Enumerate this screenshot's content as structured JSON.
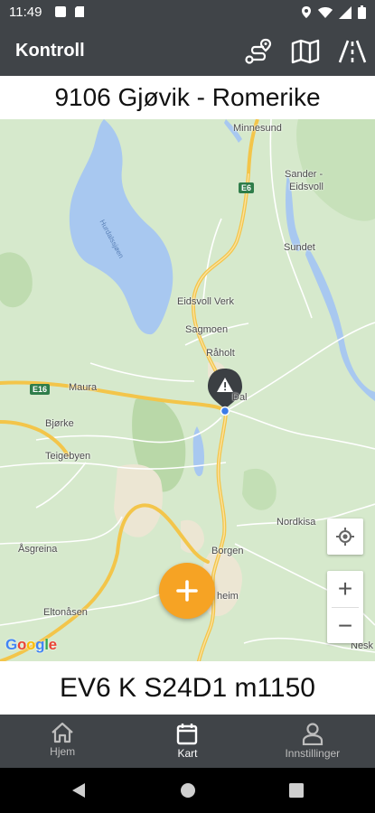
{
  "status_bar": {
    "time": "11:49",
    "left_icons": [
      "app-notification-icon",
      "sd-card-icon"
    ],
    "right_icons": [
      "location-icon",
      "wifi-icon",
      "signal-icon",
      "battery-icon"
    ]
  },
  "app_bar": {
    "title": "Kontroll",
    "actions": [
      "route-icon",
      "map-icon",
      "road-icon"
    ]
  },
  "route_title": "9106 Gjøvik - Romerike",
  "map": {
    "places": {
      "minnesund": "Minnesund",
      "sander": "Sander -",
      "eidsvoll": "Eidsvoll",
      "sundet": "Sundet",
      "eidsvoll_verk": "Eidsvoll Verk",
      "sagmoen": "Sagmoen",
      "raholt": "Råholt",
      "dal": "Dal",
      "maura": "Maura",
      "bjorke": "Bjørke",
      "teigebyen": "Teigebyen",
      "nordkisa": "Nordkisa",
      "asgreina": "Åsgreina",
      "borgen": "Borgen",
      "jessheim": "heim",
      "eltonasen": "Eltonåsen",
      "nesk": "Nesk"
    },
    "lake_label": "Hurdalssjøen",
    "road_shields": {
      "e6_north": "E6",
      "e16": "E16"
    },
    "marker_icon": "warning-marker-icon",
    "controls": {
      "locate_icon": "my-location-icon",
      "zoom_in": "+",
      "zoom_out": "−"
    },
    "attribution": "Google",
    "colors": {
      "land": "#cfe5c6",
      "water": "#a8c8f0",
      "major_road": "#f3c54a",
      "urban": "#efe9d9"
    }
  },
  "fab": {
    "icon": "plus-icon",
    "color": "#f6a324"
  },
  "road_reference": "EV6 K S24D1 m1150",
  "bottom_nav": [
    {
      "label": "Hjem",
      "icon": "home-icon",
      "active": false
    },
    {
      "label": "Kart",
      "icon": "calendar-icon",
      "active": true
    },
    {
      "label": "Innstillinger",
      "icon": "person-icon",
      "active": false
    }
  ]
}
